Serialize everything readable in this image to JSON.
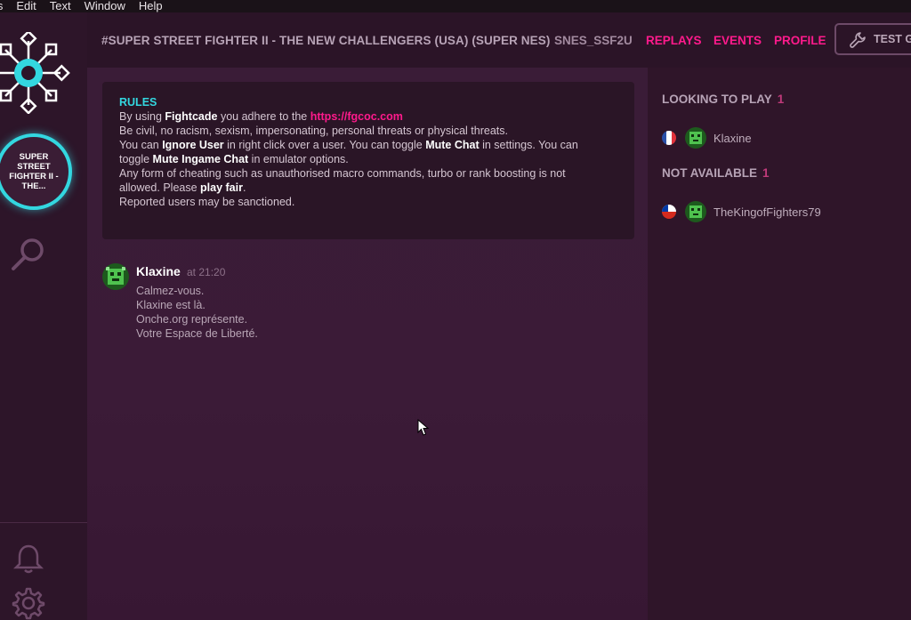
{
  "menubar": {
    "items": [
      "ls",
      "Edit",
      "Text",
      "Window",
      "Help"
    ]
  },
  "sidebar": {
    "game_label": "SUPER STREET FIGHTER II - THE...",
    "game_label_lines": [
      "SUPER",
      "STREET",
      "FIGHTER II -",
      "THE..."
    ]
  },
  "topbar": {
    "channel_title": "#SUPER STREET FIGHTER II - THE NEW CHALLENGERS (USA) (SUPER NES)",
    "channel_tag": "SNES_SSF2U",
    "nav": [
      "REPLAYS",
      "EVENTS",
      "PROFILE"
    ],
    "test_button": "TEST G"
  },
  "rules": {
    "title": "RULES",
    "l1_a": "By using ",
    "l1_b": "Fightcade",
    "l1_c": " you adhere to the ",
    "l1_link": "https://fgcoc.com",
    "l2": "Be civil, no racism, sexism, impersonating, personal threats or physical threats.",
    "l3_a": "You can ",
    "l3_b": "Ignore User",
    "l3_c": " in right click over a user. You can toggle ",
    "l3_d": "Mute Chat",
    "l3_e": " in settings. You can",
    "l4_a": "toggle ",
    "l4_b": "Mute Ingame Chat",
    "l4_c": " in emulator options.",
    "l5": "Any form of cheating such as unauthorised macro commands, turbo or rank boosting is not",
    "l6_a": "allowed. Please ",
    "l6_b": "play fair",
    "l6_c": ".",
    "l7": "Reported users may be sanctioned."
  },
  "message": {
    "author": "Klaxine",
    "time": "at 21:20",
    "lines": [
      "Calmez-vous.",
      "Klaxine est là.",
      "Onche.org représente.",
      "Votre Espace de Liberté."
    ]
  },
  "userlist": {
    "looking_label": "LOOKING TO PLAY",
    "looking_count": "1",
    "looking_users": [
      {
        "name": "Klaxine",
        "flag": "fr"
      }
    ],
    "na_label": "NOT AVAILABLE",
    "na_count": "1",
    "na_users": [
      {
        "name": "TheKingofFighters79",
        "flag": "cl"
      }
    ]
  },
  "colors": {
    "accent_cyan": "#33d7e0",
    "accent_pink": "#ff1a8c",
    "background": "#2c1629"
  },
  "icons": [
    "fightcade-logo-icon",
    "search-icon",
    "bell-icon",
    "gear-icon",
    "wrench-icon",
    "mouse-cursor-icon"
  ]
}
